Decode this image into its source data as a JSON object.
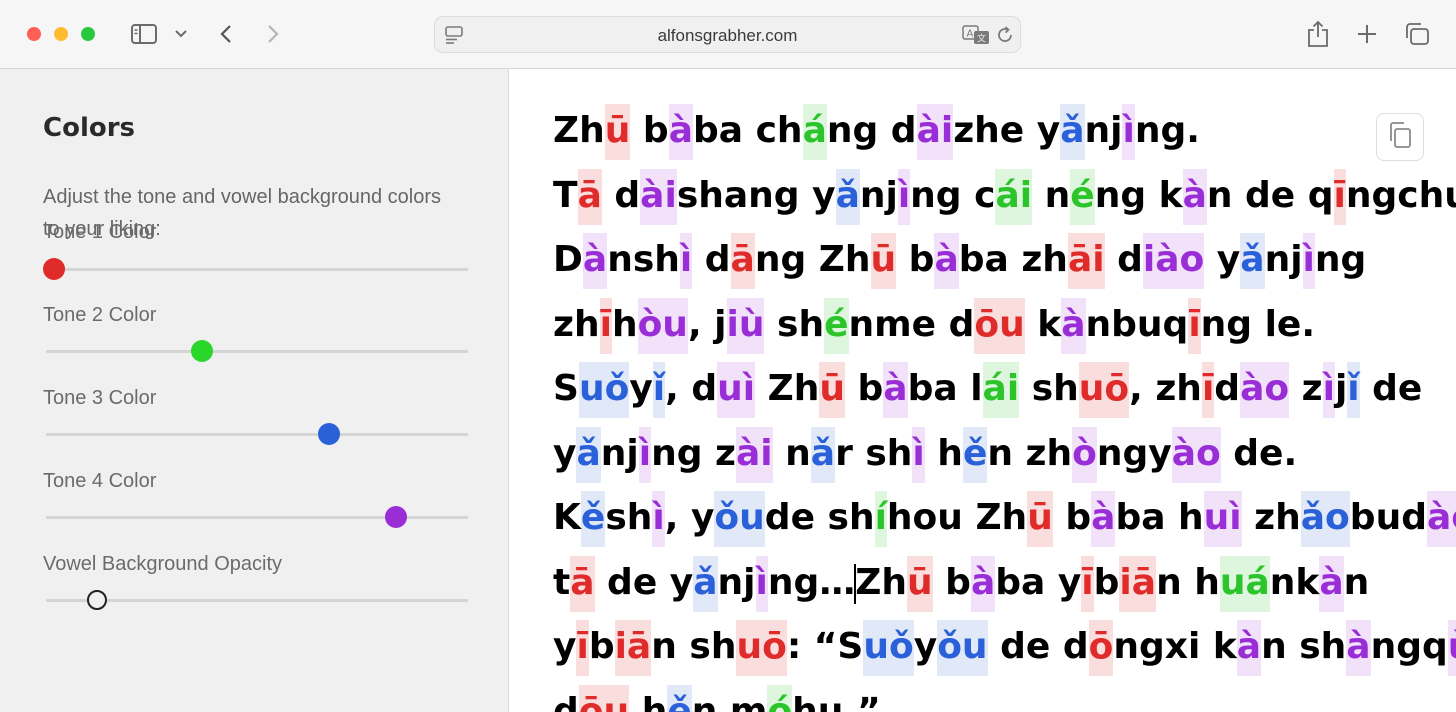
{
  "browser": {
    "url": "alfonsgrabher.com",
    "traffic_lights": [
      "#ff5f57",
      "#febc2e",
      "#28c840"
    ]
  },
  "sidebar": {
    "title": "Colors",
    "description": "Adjust the tone and vowel background colors to your liking:",
    "sliders": [
      {
        "label": "Tone 1 Color",
        "value": 0.02,
        "color": "#e02b2b"
      },
      {
        "label": "Tone 2 Color",
        "value": 0.37,
        "color": "#2bd62b"
      },
      {
        "label": "Tone 3 Color",
        "value": 0.67,
        "color": "#2a60d8"
      },
      {
        "label": "Tone 4 Color",
        "value": 0.83,
        "color": "#9a2ed6"
      },
      {
        "label": "Vowel Background Opacity",
        "value": 0.12,
        "color": "#f0f0f0"
      }
    ]
  },
  "text_lines": [
    [
      [
        "Zh",
        0
      ],
      [
        "ū",
        1
      ],
      [
        " b",
        0
      ],
      [
        "à",
        4
      ],
      [
        "ba ch",
        0
      ],
      [
        "á",
        2
      ],
      [
        "ng d",
        0
      ],
      [
        "ài",
        4
      ],
      [
        "zhe y",
        0
      ],
      [
        "ǎ",
        3
      ],
      [
        "nj",
        0
      ],
      [
        "ì",
        4
      ],
      [
        "ng.",
        0
      ]
    ],
    [
      [
        "T",
        0
      ],
      [
        "ā",
        1
      ],
      [
        " d",
        0
      ],
      [
        "ài",
        4
      ],
      [
        "shang y",
        0
      ],
      [
        "ǎ",
        3
      ],
      [
        "nj",
        0
      ],
      [
        "ì",
        4
      ],
      [
        "ng c",
        0
      ],
      [
        "ái",
        2
      ],
      [
        " n",
        0
      ],
      [
        "é",
        2
      ],
      [
        "ng k",
        0
      ],
      [
        "à",
        4
      ],
      [
        "n de q",
        0
      ],
      [
        "ī",
        1
      ],
      [
        "ngchu.",
        0
      ]
    ],
    [
      [
        "D",
        0
      ],
      [
        "à",
        4
      ],
      [
        "nsh",
        0
      ],
      [
        "ì",
        4
      ],
      [
        " d",
        0
      ],
      [
        "ā",
        1
      ],
      [
        "ng Zh",
        0
      ],
      [
        "ū",
        1
      ],
      [
        " b",
        0
      ],
      [
        "à",
        4
      ],
      [
        "ba zh",
        0
      ],
      [
        "āi",
        1
      ],
      [
        " d",
        0
      ],
      [
        "iào",
        4
      ],
      [
        " y",
        0
      ],
      [
        "ǎ",
        3
      ],
      [
        "nj",
        0
      ],
      [
        "ì",
        4
      ],
      [
        "ng",
        0
      ]
    ],
    [
      [
        "zh",
        0
      ],
      [
        "ī",
        1
      ],
      [
        "h",
        0
      ],
      [
        "òu",
        4
      ],
      [
        ", j",
        0
      ],
      [
        "iù",
        4
      ],
      [
        " sh",
        0
      ],
      [
        "é",
        2
      ],
      [
        "nme d",
        0
      ],
      [
        "ōu",
        1
      ],
      [
        " k",
        0
      ],
      [
        "à",
        4
      ],
      [
        "nbuq",
        0
      ],
      [
        "ī",
        1
      ],
      [
        "ng le.",
        0
      ]
    ],
    [
      [
        "S",
        0
      ],
      [
        "uǒ",
        3
      ],
      [
        "y",
        0
      ],
      [
        "ǐ",
        3
      ],
      [
        ", d",
        0
      ],
      [
        "uì",
        4
      ],
      [
        " Zh",
        0
      ],
      [
        "ū",
        1
      ],
      [
        " b",
        0
      ],
      [
        "à",
        4
      ],
      [
        "ba l",
        0
      ],
      [
        "ái",
        2
      ],
      [
        " sh",
        0
      ],
      [
        "uō",
        1
      ],
      [
        ", zh",
        0
      ],
      [
        "ī",
        1
      ],
      [
        "d",
        0
      ],
      [
        "ào",
        4
      ],
      [
        " z",
        0
      ],
      [
        "ì",
        4
      ],
      [
        "j",
        0
      ],
      [
        "ǐ",
        3
      ],
      [
        " de",
        0
      ]
    ],
    [
      [
        "y",
        0
      ],
      [
        "ǎ",
        3
      ],
      [
        "nj",
        0
      ],
      [
        "ì",
        4
      ],
      [
        "ng z",
        0
      ],
      [
        "ài",
        4
      ],
      [
        " n",
        0
      ],
      [
        "ǎ",
        3
      ],
      [
        "r sh",
        0
      ],
      [
        "ì",
        4
      ],
      [
        " h",
        0
      ],
      [
        "ě",
        3
      ],
      [
        "n zh",
        0
      ],
      [
        "ò",
        4
      ],
      [
        "ngy",
        0
      ],
      [
        "ào",
        4
      ],
      [
        " de.",
        0
      ]
    ],
    [
      [
        "K",
        0
      ],
      [
        "ě",
        3
      ],
      [
        "sh",
        0
      ],
      [
        "ì",
        4
      ],
      [
        ", y",
        0
      ],
      [
        "ǒu",
        3
      ],
      [
        "de sh",
        0
      ],
      [
        "í",
        2
      ],
      [
        "hou Zh",
        0
      ],
      [
        "ū",
        1
      ],
      [
        " b",
        0
      ],
      [
        "à",
        4
      ],
      [
        "ba h",
        0
      ],
      [
        "uì",
        4
      ],
      [
        " zh",
        0
      ],
      [
        "ǎo",
        3
      ],
      [
        "bud",
        0
      ],
      [
        "ào",
        4
      ]
    ],
    [
      [
        "t",
        0
      ],
      [
        "ā",
        1
      ],
      [
        " de y",
        0
      ],
      [
        "ǎ",
        3
      ],
      [
        "nj",
        0
      ],
      [
        "ì",
        4
      ],
      [
        "ng…",
        0
      ],
      [
        "|",
        9
      ],
      [
        "Zh",
        0
      ],
      [
        "ū",
        1
      ],
      [
        " b",
        0
      ],
      [
        "à",
        4
      ],
      [
        "ba y",
        0
      ],
      [
        "ī",
        1
      ],
      [
        "b",
        0
      ],
      [
        "iā",
        1
      ],
      [
        "n h",
        0
      ],
      [
        "uá",
        2
      ],
      [
        "nk",
        0
      ],
      [
        "à",
        4
      ],
      [
        "n",
        0
      ]
    ],
    [
      [
        "y",
        0
      ],
      [
        "ī",
        1
      ],
      [
        "b",
        0
      ],
      [
        "iā",
        1
      ],
      [
        "n sh",
        0
      ],
      [
        "uō",
        1
      ],
      [
        ": “S",
        0
      ],
      [
        "uǒ",
        3
      ],
      [
        "y",
        0
      ],
      [
        "ǒu",
        3
      ],
      [
        " de d",
        0
      ],
      [
        "ō",
        1
      ],
      [
        "ngxi k",
        0
      ],
      [
        "à",
        4
      ],
      [
        "n sh",
        0
      ],
      [
        "à",
        4
      ],
      [
        "ngq",
        0
      ],
      [
        "ù",
        4
      ]
    ],
    [
      [
        "d",
        0
      ],
      [
        "ōu",
        1
      ],
      [
        " h",
        0
      ],
      [
        "ě",
        3
      ],
      [
        "n m",
        0
      ],
      [
        "ó",
        2
      ],
      [
        "hu.”",
        0
      ]
    ]
  ]
}
